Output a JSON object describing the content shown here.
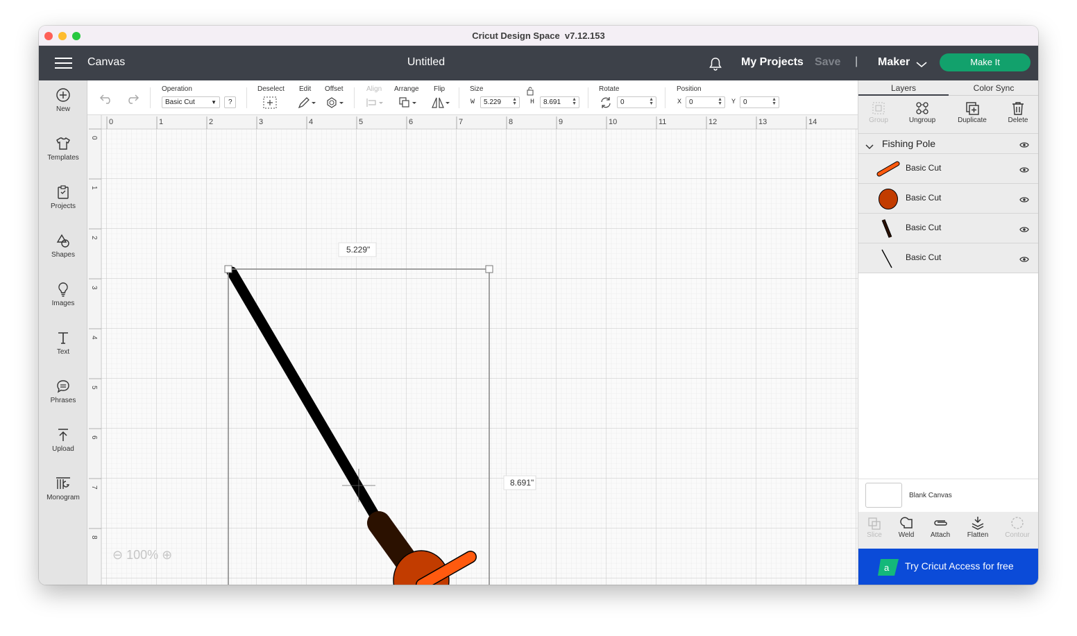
{
  "window": {
    "title": "Cricut Design Space  v7.12.153"
  },
  "header": {
    "section_title": "Canvas",
    "document_title": "Untitled",
    "my_projects_label": "My Projects",
    "save_label": "Save",
    "separator": "|",
    "machine_label": "Maker",
    "make_it_label": "Make It"
  },
  "left_nav": {
    "items": [
      {
        "label": "New",
        "icon": "plus-circle-icon"
      },
      {
        "label": "Templates",
        "icon": "tshirt-icon"
      },
      {
        "label": "Projects",
        "icon": "clipboard-icon"
      },
      {
        "label": "Shapes",
        "icon": "shapes-icon"
      },
      {
        "label": "Images",
        "icon": "lightbulb-icon"
      },
      {
        "label": "Text",
        "icon": "text-t-icon"
      },
      {
        "label": "Phrases",
        "icon": "speech-bubble-icon"
      },
      {
        "label": "Upload",
        "icon": "upload-arrow-icon"
      },
      {
        "label": "Monogram",
        "icon": "monogram-icon"
      }
    ]
  },
  "toolbar": {
    "operation_label": "Operation",
    "operation_value": "Basic Cut",
    "help_label": "?",
    "deselect_label": "Deselect",
    "edit_label": "Edit",
    "offset_label": "Offset",
    "align_label": "Align",
    "arrange_label": "Arrange",
    "flip_label": "Flip",
    "size_label": "Size",
    "width_prefix": "W",
    "width_value": "5.229",
    "height_prefix": "H",
    "height_value": "8.691",
    "rotate_label": "Rotate",
    "rotate_value": "0",
    "position_label": "Position",
    "x_prefix": "X",
    "x_value": "0",
    "y_prefix": "Y",
    "y_value": "0"
  },
  "canvas": {
    "ruler_h_labels": [
      "0",
      "1",
      "2",
      "3",
      "4",
      "5",
      "6",
      "7",
      "8",
      "9",
      "10",
      "11",
      "12",
      "13",
      "14"
    ],
    "ruler_v_labels": [
      "0",
      "1",
      "2",
      "3",
      "4",
      "5",
      "6",
      "7",
      "8"
    ],
    "width_dimension_label": "5.229\"",
    "height_dimension_label": "8.691\"",
    "zoom_level": "100%",
    "colors": {
      "pole": "#000000",
      "handle": "#2b1100",
      "reel": "#c23c00",
      "reel_arm": "#ff5a0f"
    }
  },
  "right_panel": {
    "tabs": [
      "Layers",
      "Color Sync"
    ],
    "actions": {
      "group": "Group",
      "ungroup": "Ungroup",
      "duplicate": "Duplicate",
      "delete": "Delete"
    },
    "group_name": "Fishing Pole",
    "layers": [
      {
        "label": "Basic Cut",
        "color": "#ff5a0f",
        "shape": "reel-arm"
      },
      {
        "label": "Basic Cut",
        "color": "#c23c00",
        "shape": "reel-circle"
      },
      {
        "label": "Basic Cut",
        "color": "#2b1100",
        "shape": "handle"
      },
      {
        "label": "Basic Cut",
        "color": "#000000",
        "shape": "pole-line"
      }
    ],
    "blank_canvas_label": "Blank Canvas",
    "bottom_actions": {
      "slice": "Slice",
      "weld": "Weld",
      "attach": "Attach",
      "flatten": "Flatten",
      "contour": "Contour"
    },
    "access_banner": "Try Cricut Access for free"
  }
}
